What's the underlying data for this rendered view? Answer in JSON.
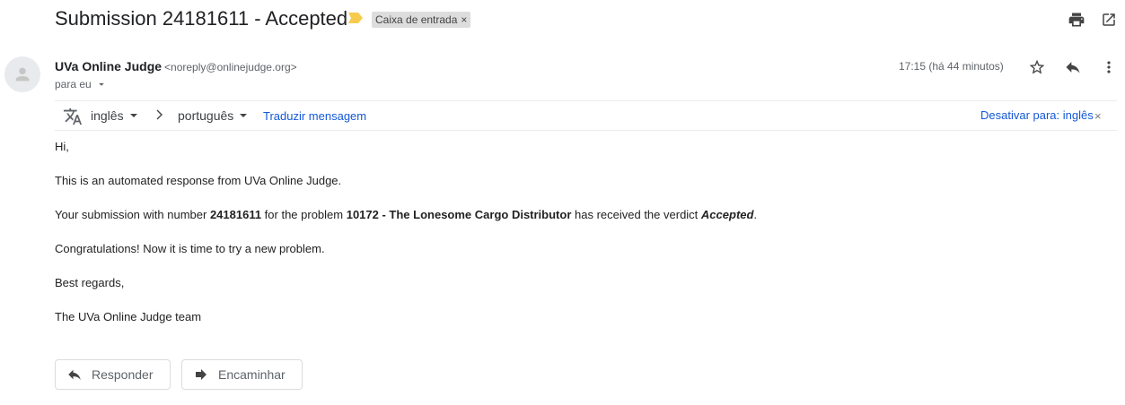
{
  "subject": "Submission 24181611 - Accepted",
  "label": "Caixa de entrada",
  "label_remove": "×",
  "sender": {
    "name": "UVa Online Judge",
    "email": "<noreply@onlinejudge.org>"
  },
  "to_line": "para eu",
  "timestamp": "17:15 (há 44 minutos)",
  "translation": {
    "source_lang": "inglês",
    "target_lang": "português",
    "translate_link": "Traduzir mensagem",
    "deactivate": "Desativar para: inglês",
    "deactivate_close": "×"
  },
  "body": {
    "greeting": "Hi,",
    "line1": "This is an automated response from UVa Online Judge.",
    "line2_a": "Your submission with number ",
    "submission_number": "24181611",
    "line2_b": " for the problem ",
    "problem": "10172 - The Lonesome Cargo Distributor",
    "line2_c": " has received the verdict ",
    "verdict": "Accepted",
    "line2_d": ".",
    "line3": "Congratulations! Now it is time to try a new problem.",
    "line4": "Best regards,",
    "line5": "The UVa Online Judge team"
  },
  "buttons": {
    "reply": "Responder",
    "forward": "Encaminhar"
  },
  "colors": {
    "importance_marker": "#f7cb4d",
    "link": "#1558d6",
    "label_bg": "#dddddd"
  },
  "icons": {
    "print": "print-icon",
    "open_new_window": "open-in-new-window-icon",
    "star": "star-icon",
    "reply": "reply-icon",
    "more": "more-vert-icon",
    "translate": "translate-icon",
    "forward": "forward-icon"
  }
}
